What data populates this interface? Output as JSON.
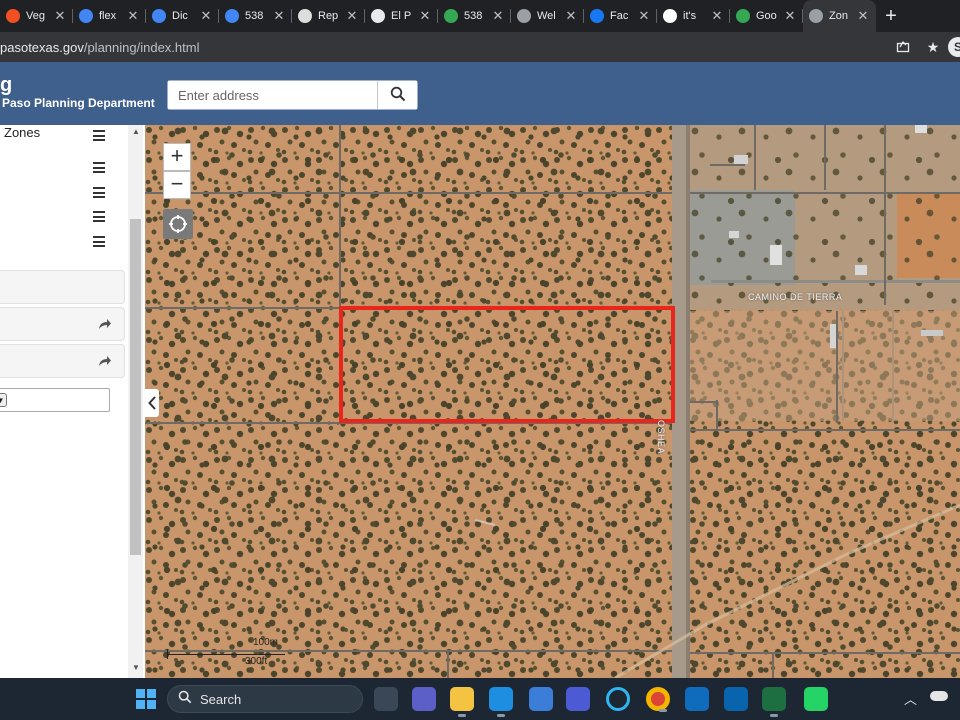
{
  "browser": {
    "tabs": [
      {
        "label": "Veg",
        "icon": "windows-logo-icon",
        "color": "#f25022",
        "active": false
      },
      {
        "label": "flex",
        "icon": "globe-icon",
        "color": "#4285f4",
        "active": false
      },
      {
        "label": "Dic",
        "icon": "globe-icon",
        "color": "#4285f4",
        "active": false
      },
      {
        "label": "538",
        "icon": "upload-icon",
        "color": "#4285f4",
        "active": false
      },
      {
        "label": "Rep",
        "icon": "gear-icon",
        "color": "#dddddd",
        "active": false
      },
      {
        "label": "El P",
        "icon": "document-icon",
        "color": "#e8eaed",
        "active": false
      },
      {
        "label": "538",
        "icon": "maps-pin-icon",
        "color": "#34a853",
        "active": false
      },
      {
        "label": "Wel",
        "icon": "globe-icon",
        "color": "#9aa0a6",
        "active": false
      },
      {
        "label": "Fac",
        "icon": "facebook-icon",
        "color": "#1877f2",
        "active": false
      },
      {
        "label": "it's",
        "icon": "google-icon",
        "color": "#ffffff",
        "active": false
      },
      {
        "label": "Goo",
        "icon": "maps-pin-icon",
        "color": "#34a853",
        "active": false
      },
      {
        "label": "Zon",
        "icon": "globe-icon",
        "color": "#9aa0a6",
        "active": true
      }
    ],
    "close_glyph": "✕",
    "new_tab_glyph": "+",
    "url_host": "pasotexas.gov",
    "url_path": "/planning/index.html",
    "profile_initial": "S"
  },
  "app": {
    "title": "g",
    "subtitle": "Paso Planning Department",
    "search_placeholder": "Enter address"
  },
  "sidepanel": {
    "layers": [
      {
        "label": "Zones"
      },
      {
        "label": ""
      },
      {
        "label": ""
      },
      {
        "label": ""
      },
      {
        "label": ""
      }
    ],
    "text_fragment": "l"
  },
  "map": {
    "zoom_in": "+",
    "zoom_out": "−",
    "road_camino": "CAMINO DE TIERRA",
    "road_oshea": "OSHEA",
    "scale_metric": "100m",
    "scale_imperial": "300ft",
    "highlight_color": "#e8261c"
  },
  "taskbar": {
    "search_label": "Search",
    "apps": [
      {
        "name": "task-view",
        "color": "#3a4756"
      },
      {
        "name": "teams-chat",
        "color": "#5b5fc7"
      },
      {
        "name": "file-explorer",
        "color": "#f5c342"
      },
      {
        "name": "edge",
        "color": "#1e8fe0"
      },
      {
        "name": "store",
        "color": "#3b7dd8"
      },
      {
        "name": "pen-app",
        "color": "#4c5bd4"
      },
      {
        "name": "cortana",
        "color": "#1c2733"
      },
      {
        "name": "chrome",
        "color": "#db4437"
      },
      {
        "name": "outlook-calendar",
        "color": "#0f6cbd"
      },
      {
        "name": "outlook",
        "color": "#0a64ad"
      },
      {
        "name": "excel",
        "color": "#1d6f42"
      },
      {
        "name": "whatsapp",
        "color": "#25d366"
      }
    ]
  }
}
